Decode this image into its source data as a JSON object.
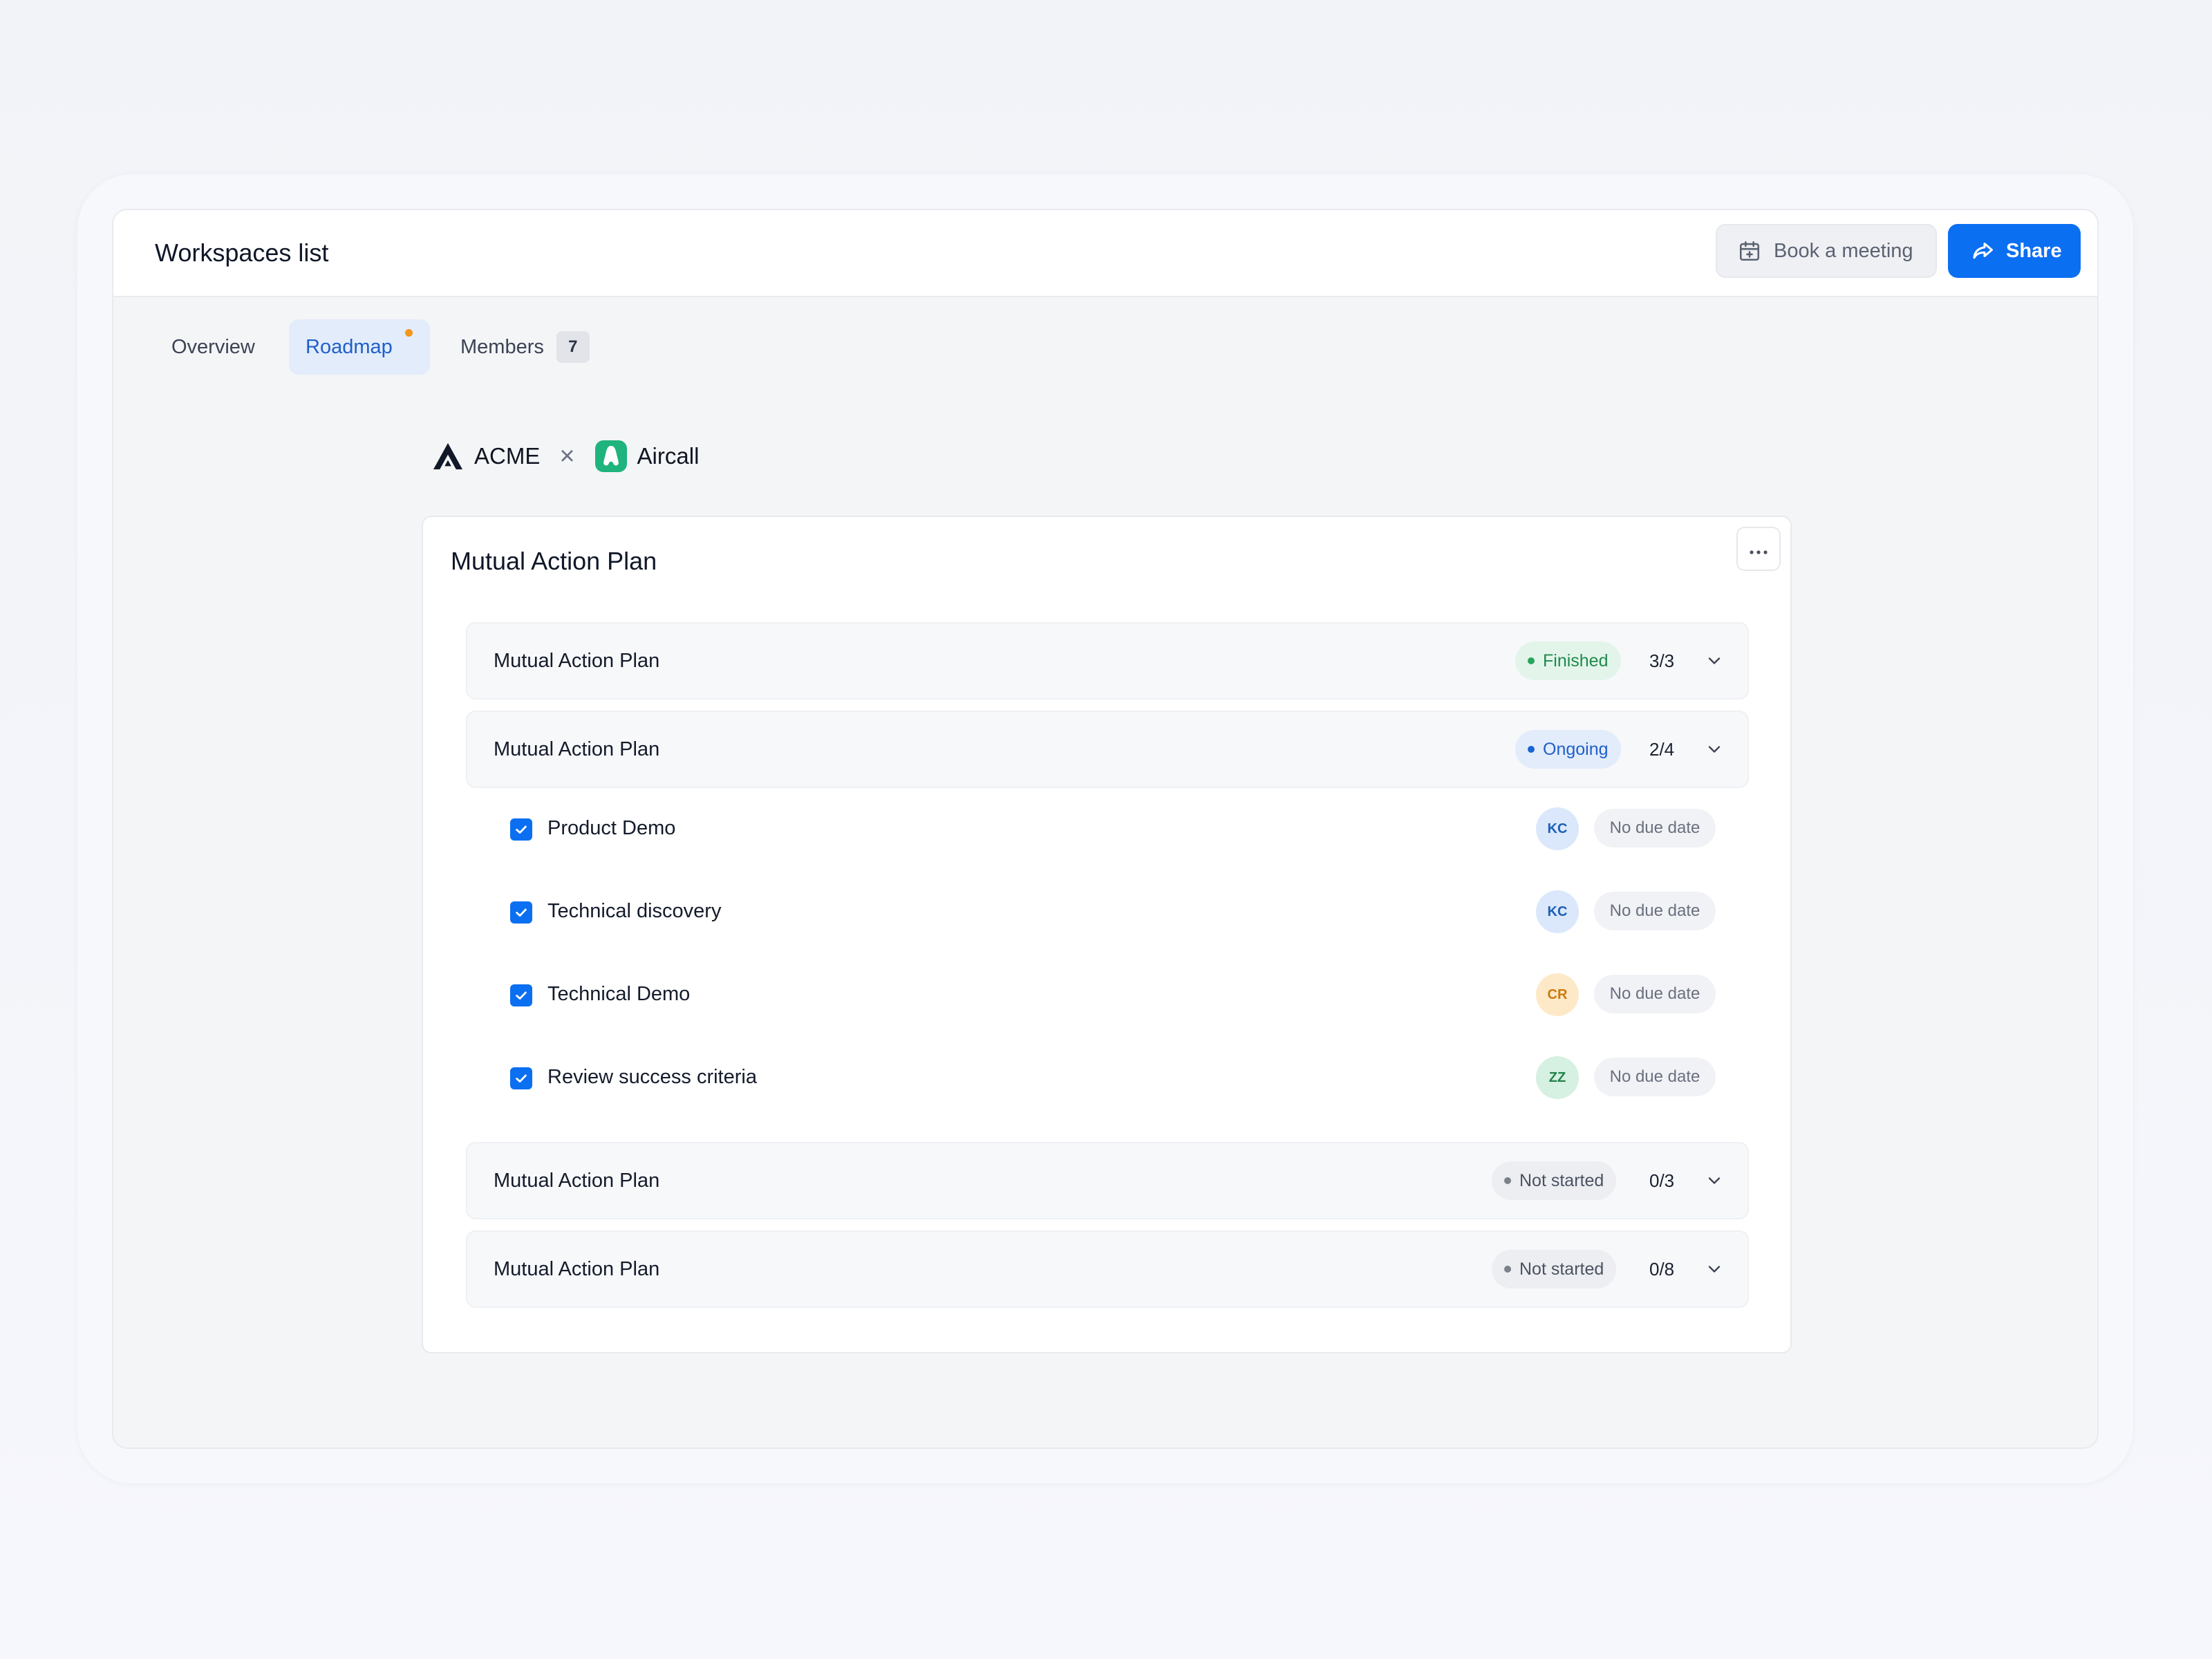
{
  "header": {
    "title": "Workspaces list",
    "book_label": "Book a meeting",
    "share_label": "Share"
  },
  "tabs": [
    {
      "label": "Overview"
    },
    {
      "label": "Roadmap",
      "active": true,
      "has_notification": true
    },
    {
      "label": "Members",
      "count": "7"
    }
  ],
  "partnership": {
    "left_brand": "ACME",
    "separator": "×",
    "right_brand": "Aircall"
  },
  "plan": {
    "title": "Mutual Action Plan",
    "groups": [
      {
        "name": "Mutual Action Plan",
        "status": "Finished",
        "progress": "3/3"
      },
      {
        "name": "Mutual Action Plan",
        "status": "Ongoing",
        "progress": "2/4",
        "expanded": true
      },
      {
        "name": "Mutual Action Plan",
        "status": "Not started",
        "progress": "0/3"
      },
      {
        "name": "Mutual Action Plan",
        "status": "Not started",
        "progress": "0/8"
      }
    ],
    "tasks": [
      {
        "name": "Product Demo",
        "assignee": "KC",
        "due": "No due date",
        "checked": true
      },
      {
        "name": "Technical discovery",
        "assignee": "KC",
        "due": "No due date",
        "checked": true
      },
      {
        "name": "Technical Demo",
        "assignee": "CR",
        "due": "No due date",
        "checked": true
      },
      {
        "name": "Review success criteria",
        "assignee": "ZZ",
        "due": "No due date",
        "checked": true
      }
    ]
  },
  "colors": {
    "accent": "#0b6ff2",
    "finished": "#1f8a4c",
    "ongoing": "#1f5fc9",
    "not_started": "#4b5262",
    "notification_dot": "#f5961b",
    "aircall_brand": "#1fb37e"
  },
  "icons": {
    "book": "calendar-plus-icon",
    "share": "share-arrow-icon",
    "more": "more-horizontal-icon",
    "chevron": "chevron-down-icon",
    "check": "check-icon"
  }
}
